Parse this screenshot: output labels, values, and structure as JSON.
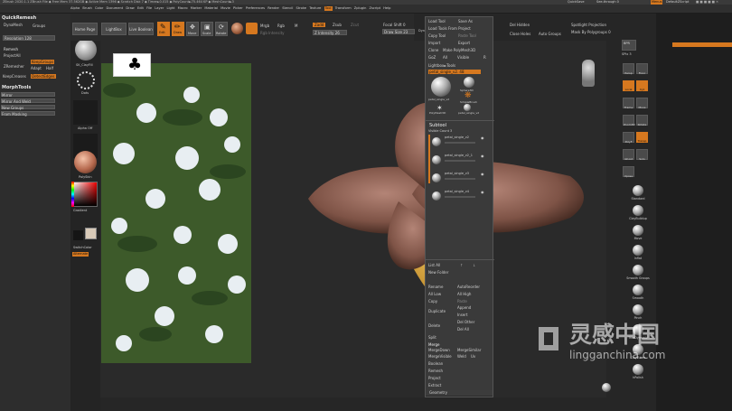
{
  "app": {
    "title_left": "ZBrush 2020.1.1  ZBrush File  ◆ Free Mem 37.562GB ◆ Active Mem 1396 ◆ Scratch Disk 7 ◆ Timer►0.015 ◆ PolyCount►75.464 KP ◆ MeshCount►3",
    "quicksave": "QuickSave",
    "seethrough": "See-through  0",
    "menus": "Menus",
    "defaultscript": "DefaultZScript"
  },
  "menu_items": [
    "Alpha",
    "Brush",
    "Color",
    "Document",
    "Draw",
    "Edit",
    "File",
    "Layer",
    "Light",
    "Macro",
    "Marker",
    "Material",
    "Movie",
    "Picker",
    "Preferences",
    "Render",
    "Stencil",
    "Stroke",
    "Texture",
    "Tool",
    "Transform",
    "Zplugin",
    "Zscript",
    "Help"
  ],
  "left_panel": {
    "quickremesh": "QuickRemesh",
    "dynamesh": "DynaMesh",
    "groups": "Groups",
    "resolution": "Resolution 128",
    "remesh": "Remesh",
    "projectall": "ProjectAll",
    "zremesher": "ZRemesher",
    "keepgroups": "KeepGroups",
    "adapt": "Adapt",
    "half": "Half",
    "keepcreases": "KeepCreases",
    "detectedges": "DetectEdges",
    "morphtools": "MorphTools",
    "mirror": "Mirror",
    "mirror_weld": "Mirror And Weld",
    "newgroups": "New Groups",
    "frommasking": "From Masking"
  },
  "left_tray": {
    "brush": "SK_ClayFill",
    "dots": "Dots",
    "alpha": "Alpha Off",
    "texture": "Texture Off",
    "material": "PolySkin",
    "gradient": "Gradient",
    "switchcolor": "SwitchColor",
    "alternate": "Alternate"
  },
  "top_shelf": {
    "homepage": "Home Page",
    "lightbox": "LightBox",
    "liveboolean": "Live Boolean",
    "edit": "Edit",
    "draw": "Draw",
    "move": "Move",
    "scale": "Scale",
    "rotate": "Rotate",
    "mrgb": "Mrgb",
    "rgb": "Rgb",
    "m": "M",
    "zadd": "Zadd",
    "zsub": "Zsub",
    "zcut": "Zcut",
    "rgb_intensity": "Rgb Intensity",
    "z_intensity": "Z Intensity 26",
    "focal_shift": "Focal Shift 0",
    "draw_size": "Draw Size 23",
    "dynamic": "Dynamic",
    "del_hidden": "Del Hidden",
    "close_holes": "Close Holes",
    "auto_groups": "Auto Groups",
    "spotlight": "Spotlight Projection",
    "mask_polygroups": "Mask By Polygroups 0"
  },
  "tool_menu": {
    "load_tool": "Load Tool",
    "save_as": "Save As",
    "load_tools_project": "Load Tools From Project",
    "copy_tool": "Copy Tool",
    "paste_tool": "Paste Tool",
    "import": "Import",
    "export": "Export",
    "clone": "Clone",
    "make_polymesh": "Make PolyMesh3D",
    "goz": "GoZ",
    "all": "All",
    "visible": "Visible",
    "r": "R",
    "lightbox_tools": "Lightbox►Tools",
    "current_tool": "petal_single_v2. 48",
    "thumb1": "petal_single_v2",
    "thumb2": "Sphere3D",
    "thumb3": "SimpleBrush",
    "thumb4": "PolyMesh3D",
    "thumb5": "petal_single_v2",
    "subtool": "Subtool",
    "visible_count": "Visible Count 3",
    "subtools": [
      "petal_single_v2",
      "petal_single_v2_1",
      "petal_single_v3",
      "petal_single_v4"
    ],
    "list_all": "List All",
    "new_folder": "New Folder",
    "rename": "Rename",
    "autoreorder": "AutoReorder",
    "all_low": "All Low",
    "all_high": "All High",
    "copy": "Copy",
    "paste": "Paste",
    "duplicate": "Duplicate",
    "append": "Append",
    "insert": "Insert",
    "delete": "Delete",
    "del_other": "Del Other",
    "del_all": "Del All",
    "split": "Split",
    "merge": "Merge",
    "mergedown": "MergeDown",
    "mergesimilar": "MergeSimilar",
    "mergevisible": "MergeVisible",
    "weld": "Weld",
    "uv": "Uv",
    "boolean": "Boolean",
    "remesh": "Remesh",
    "project": "Project",
    "extract": "Extract",
    "geometry": "Geometry"
  },
  "right_bar": {
    "bpr": "BPR",
    "spix": "SPix 3",
    "persp": "Persp",
    "floor": "Floor",
    "local": "Local",
    "xyz": "Xyz",
    "frame": "Frame",
    "move": "Move",
    "zoom3d": "Zoom3D",
    "rotate": "Rotate",
    "polyf": "PolyF",
    "transp": "Transp",
    "ghost": "Ghost",
    "solo": "Solo",
    "xpose": "Xpose"
  },
  "brush_list": [
    "Standard",
    "ClayBuildup",
    "Move",
    "Inflat",
    "Smooth Groups",
    "Smooth",
    "Pinch",
    "TrimDynamic",
    "ClayTubes",
    "hPolish"
  ],
  "watermark": {
    "cn": "灵感中国",
    "url": "lingganchina.com"
  },
  "colors": {
    "accent": "#d6781f",
    "panel": "#2d2d2d",
    "menu": "#3a3a3a"
  }
}
